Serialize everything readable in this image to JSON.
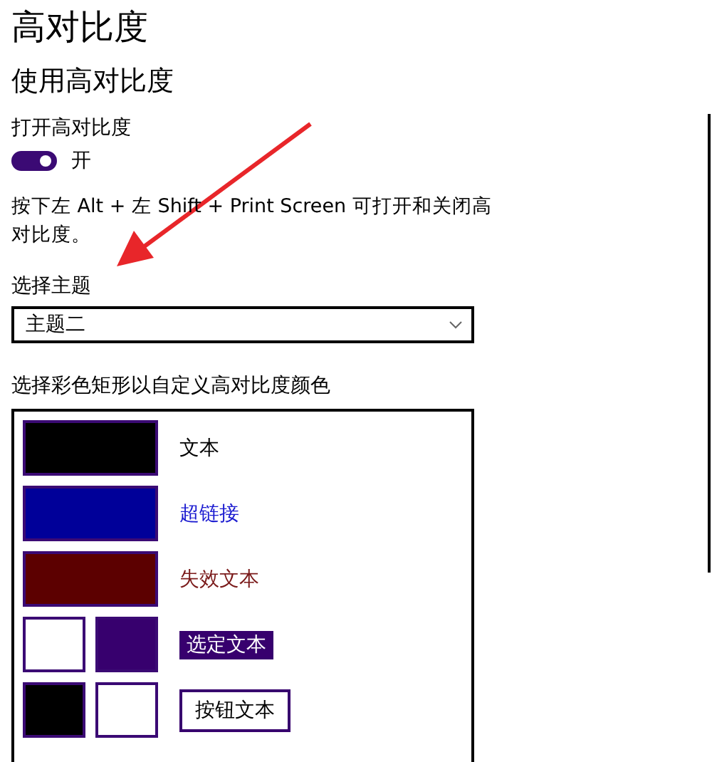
{
  "page_title": "高对比度",
  "section_title": "使用高对比度",
  "toggle": {
    "label": "打开高对比度",
    "on": true,
    "state_text": "开"
  },
  "description": "按下左 Alt + 左 Shift + Print Screen 可打开和关闭高对比度。",
  "theme": {
    "label": "选择主题",
    "value": "主题二"
  },
  "colors": {
    "label": "选择彩色矩形以自定义高对比度颜色",
    "items": [
      {
        "kind": "text",
        "swatches": [
          {
            "color": "#000000"
          }
        ],
        "label": "文本",
        "color": "#000000"
      },
      {
        "kind": "text",
        "swatches": [
          {
            "color": "#000099"
          }
        ],
        "label": "超链接",
        "color": "#1a1ad0"
      },
      {
        "kind": "text",
        "swatches": [
          {
            "color": "#5c0000"
          }
        ],
        "label": "失效文本",
        "color": "#7a1a1a"
      },
      {
        "kind": "highlight",
        "swatches": [
          {
            "color": "#ffffff"
          },
          {
            "color": "#37006e"
          }
        ],
        "label": "选定文本",
        "color": "#37006e"
      },
      {
        "kind": "button",
        "swatches": [
          {
            "color": "#000000"
          },
          {
            "color": "#ffffff"
          }
        ],
        "label": "按钮文本",
        "color": "#37006e"
      }
    ]
  },
  "annotation": {
    "kind": "arrow",
    "color": "#e8262a"
  }
}
